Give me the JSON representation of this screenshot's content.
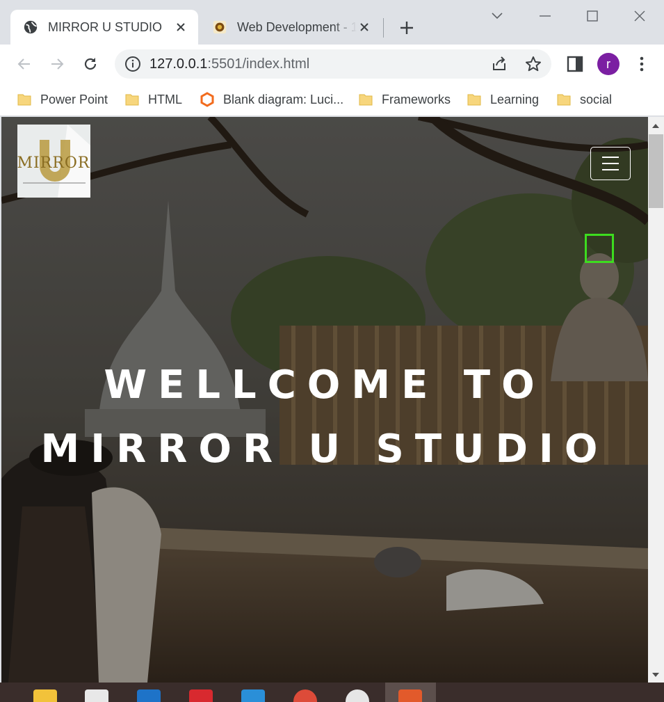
{
  "tabs": [
    {
      "title": "MIRROR U STUDIO",
      "active": true
    },
    {
      "title": "Web Development - 1",
      "active": false
    }
  ],
  "toolbar": {
    "url_host": "127.0.0.1",
    "url_port": ":5501",
    "url_path": "/index.html",
    "avatar_letter": "r"
  },
  "bookmarks": [
    {
      "label": "Power Point",
      "icon": "folder-icon"
    },
    {
      "label": "HTML",
      "icon": "folder-icon"
    },
    {
      "label": "Blank diagram: Luci...",
      "icon": "lucid-icon"
    },
    {
      "label": "Frameworks",
      "icon": "folder-icon"
    },
    {
      "label": "Learning",
      "icon": "folder-icon"
    },
    {
      "label": "social",
      "icon": "folder-icon"
    }
  ],
  "page": {
    "logo_text": "MIRROR",
    "hero_line1": "WELLCOME TO",
    "hero_line2": "MIRROR U STUDIO"
  },
  "colors": {
    "accent_green": "#3ddc1f",
    "avatar": "#7b1fa2",
    "logo_gold": "#b89a3e"
  }
}
